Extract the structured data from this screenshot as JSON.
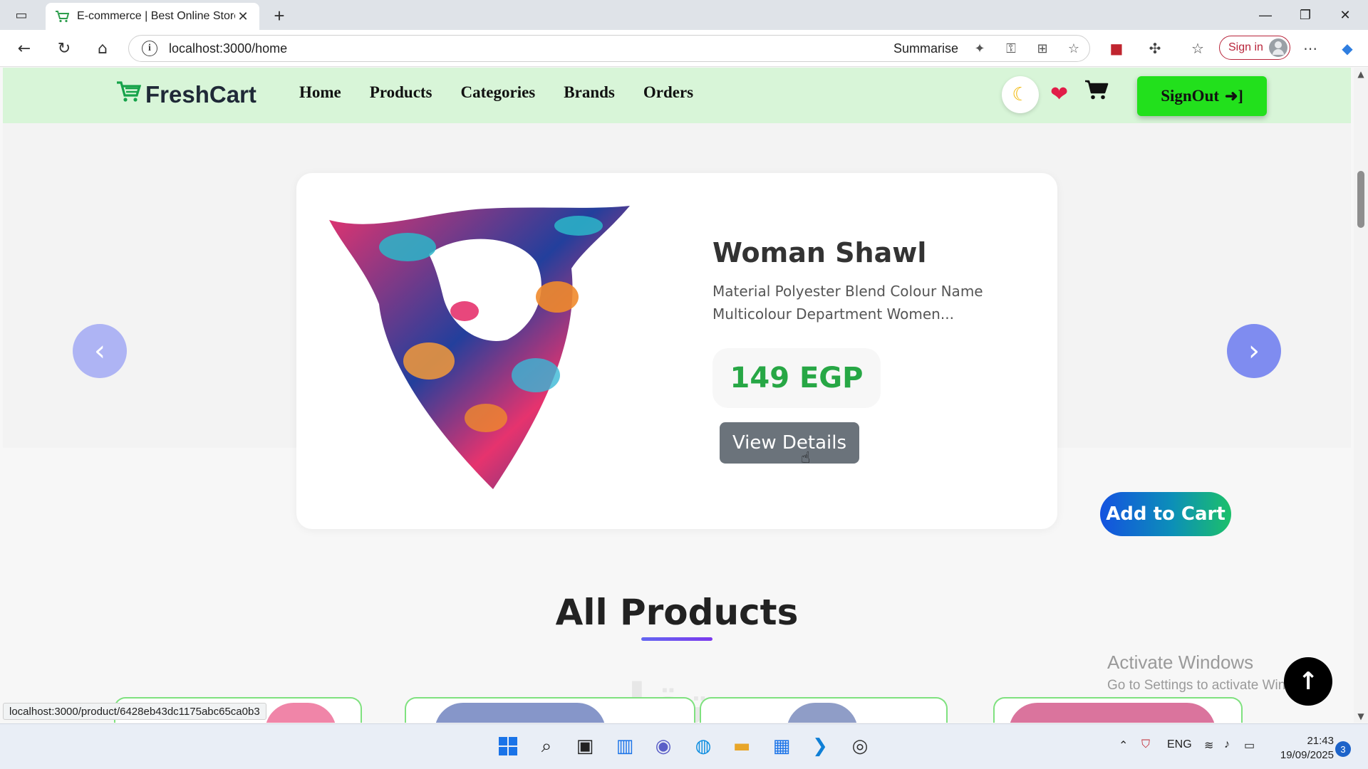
{
  "browser": {
    "tab_title": "E-commerce | Best Online Store",
    "tab_close": "✕",
    "new_tab": "+",
    "url": "localhost:3000/home",
    "summarise_label": "Summarise",
    "sign_in_label": "Sign in",
    "window_controls": {
      "minimize": "—",
      "restore": "❐",
      "close": "✕"
    }
  },
  "site": {
    "brand": "FreshCart",
    "nav": [
      "Home",
      "Products",
      "Categories",
      "Brands",
      "Orders"
    ],
    "signout_label": "SignOut"
  },
  "slider": {
    "product_title": "Woman Shawl",
    "description": "Material Polyester Blend Colour Name Multicolour Department Women...",
    "price": "149 EGP",
    "view_details_label": "View Details",
    "add_to_cart_label": "Add to Cart",
    "prev_arrow": "‹",
    "next_arrow": "›"
  },
  "section": {
    "all_products_title": "All Products"
  },
  "overlay": {
    "activate_title": "Activate Windows",
    "activate_subtitle": "Go to Settings to activate Windows.",
    "watermark": "مستقل",
    "status_url": "localhost:3000/product/6428eb43dc1175abc65ca0b3"
  },
  "taskbar": {
    "language": "ENG",
    "time": "21:43",
    "date": "19/09/2025",
    "notifications": "3"
  },
  "colors": {
    "nav_bg": "#d8f5d8",
    "signout_bg": "#22e01c",
    "price": "#27a745",
    "view_btn": "#6b737b",
    "heart": "#e11d48",
    "brand_green": "#16a34a"
  },
  "icons": {
    "tab_favicon": "cart-icon",
    "moon": "moon-icon",
    "wishlist": "heart-icon",
    "cart": "shopping-cart-icon",
    "signout": "sign-in-arrow-icon",
    "scroll_top": "arrow-up-icon"
  }
}
